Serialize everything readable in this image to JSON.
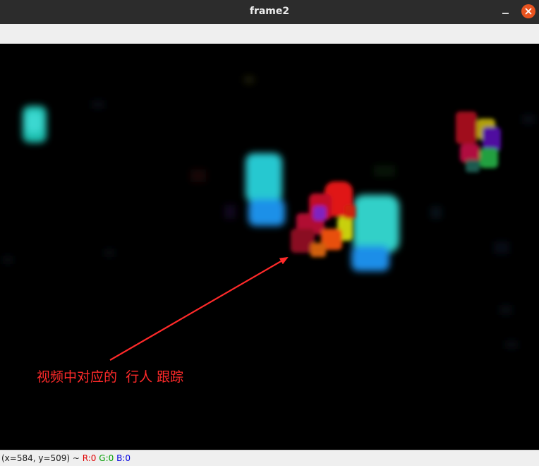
{
  "window": {
    "title": "frame2"
  },
  "icons": {
    "minimize": "minimize-icon",
    "close": "close-icon"
  },
  "colors": {
    "titlebar": "#2c2c2c",
    "close_button": "#e95420",
    "annotation": "#ff2a2a",
    "canvas": "#000000"
  },
  "annotation": {
    "text": "视频中对应的  行人 跟踪"
  },
  "status": {
    "coords": "(x=584, y=509) ~ ",
    "r": "R:0",
    "g": "G:0",
    "b": "B:0"
  }
}
